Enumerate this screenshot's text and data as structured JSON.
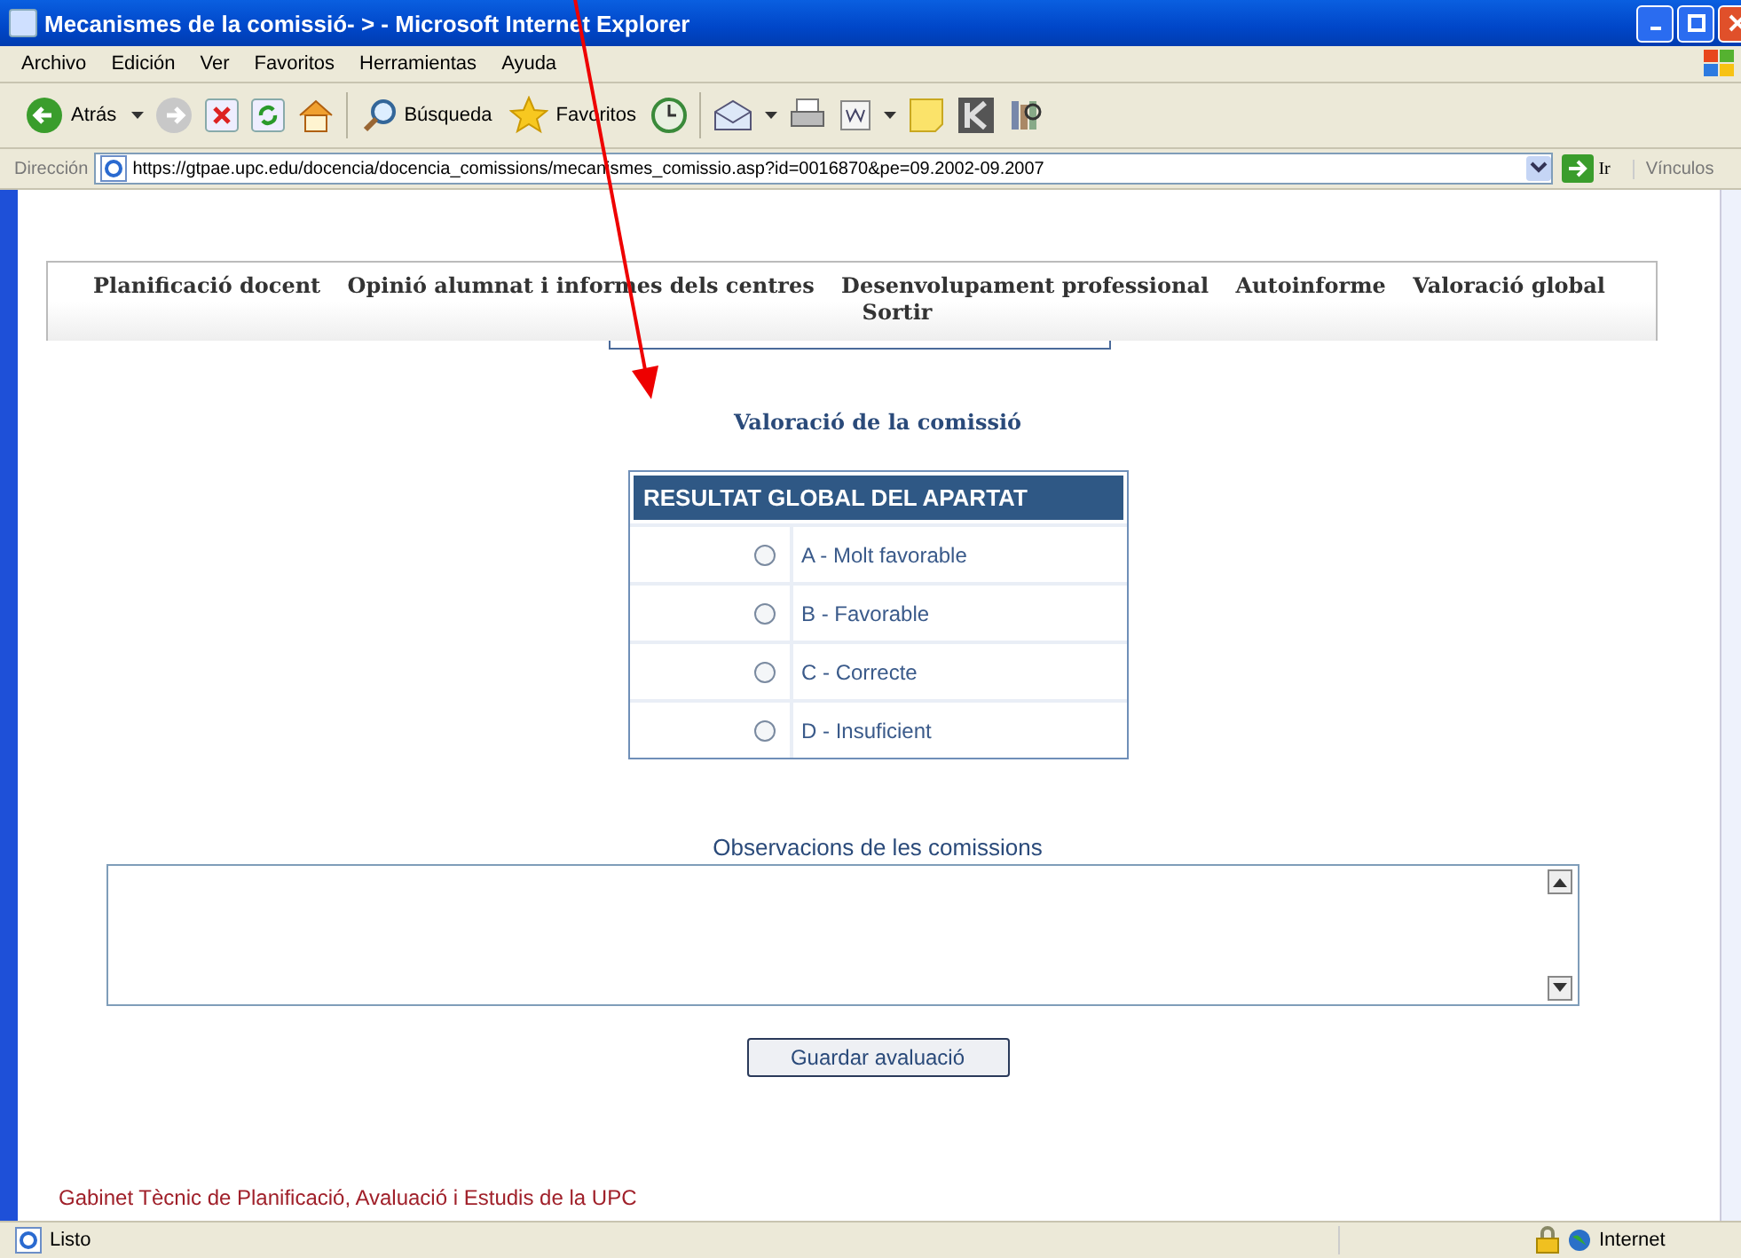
{
  "window": {
    "title": "Mecanismes de la comissió- > - Microsoft Internet Explorer"
  },
  "menu": [
    "Archivo",
    "Edición",
    "Ver",
    "Favoritos",
    "Herramientas",
    "Ayuda"
  ],
  "toolbar": {
    "back": "Atrás",
    "search": "Búsqueda",
    "favorites": "Favoritos"
  },
  "address": {
    "label": "Dirección",
    "value": "https://gtpae.upc.edu/docencia/docencia_comissions/mecanismes_comissio.asp?id=0016870&pe=09.2002-09.2007",
    "go": "Ir",
    "links": "Vínculos"
  },
  "nav": {
    "items": [
      "Planificació docent",
      "Opinió alumnat i informes dels centres",
      "Desenvolupament professional",
      "Autoinforme",
      "Valoració global"
    ],
    "exit": "Sortir"
  },
  "section_title": "Valoració de la comissió",
  "result_table": {
    "header": "RESULTAT GLOBAL DEL APARTAT",
    "options": [
      {
        "label": "A - Molt favorable",
        "selected": false
      },
      {
        "label": "B - Favorable",
        "selected": false
      },
      {
        "label": "C - Correcte",
        "selected": false
      },
      {
        "label": "D - Insuficient",
        "selected": false
      }
    ]
  },
  "observations": {
    "label": "Observacions de les comissions"
  },
  "save_button": "Guardar avaluació",
  "footer": "Gabinet Tècnic de Planificació, Avaluació i Estudis de la UPC",
  "status_bar": {
    "text": "Listo",
    "zone": "Internet"
  }
}
